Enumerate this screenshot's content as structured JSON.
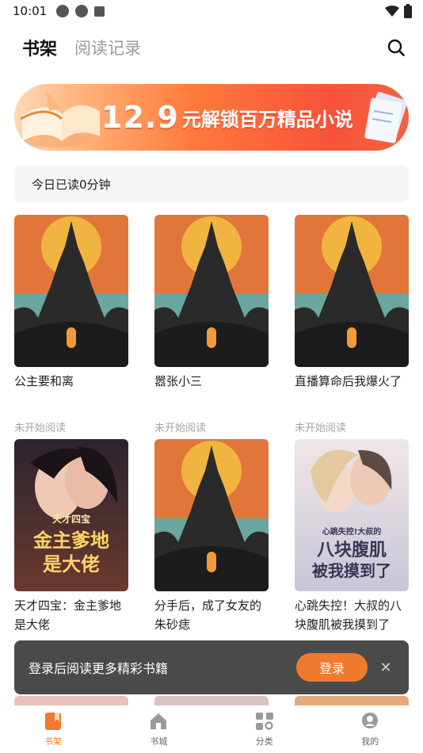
{
  "status_bar": {
    "time": "10:01"
  },
  "header": {
    "tab_bookshelf": "书架",
    "tab_history": "阅读记录",
    "search_icon": "search-icon"
  },
  "banner": {
    "price": "12.9",
    "text": "元解锁百万精品小说"
  },
  "reading": {
    "today": "今日已读0分钟"
  },
  "books": [
    {
      "title": "公主要和离",
      "status": "未开始阅读",
      "cover": "castle"
    },
    {
      "title": "嚣张小三",
      "status": "未开始阅读",
      "cover": "castle"
    },
    {
      "title": "直播算命后我爆火了",
      "status": "未开始阅读",
      "cover": "castle"
    },
    {
      "title": "天才四宝：金主爹地是大佬",
      "status": "",
      "cover": "romance-dark",
      "cover_text": [
        "天才四宝",
        "金主爹地",
        "是大佬"
      ]
    },
    {
      "title": "分手后，成了女友的朱砂痣",
      "status": "",
      "cover": "castle"
    },
    {
      "title": "心跳失控！大叔的八块腹肌被我摸到了",
      "status": "",
      "cover": "romance-light",
      "cover_text": [
        "心跳失控!大叔的",
        "八块腹肌",
        "被我摸到了"
      ]
    }
  ],
  "toast": {
    "message": "登录后阅读更多精彩书籍",
    "login_label": "登录",
    "close_icon": "close-icon"
  },
  "bottom_nav": [
    {
      "label": "书架",
      "icon": "bookshelf-icon",
      "active": true
    },
    {
      "label": "书城",
      "icon": "store-icon",
      "active": false
    },
    {
      "label": "分类",
      "icon": "category-icon",
      "active": false
    },
    {
      "label": "我的",
      "icon": "profile-icon",
      "active": false
    }
  ],
  "colors": {
    "accent": "#f07a2d",
    "toast_bg": "#4a4a4a",
    "muted": "#a5a5a5"
  }
}
